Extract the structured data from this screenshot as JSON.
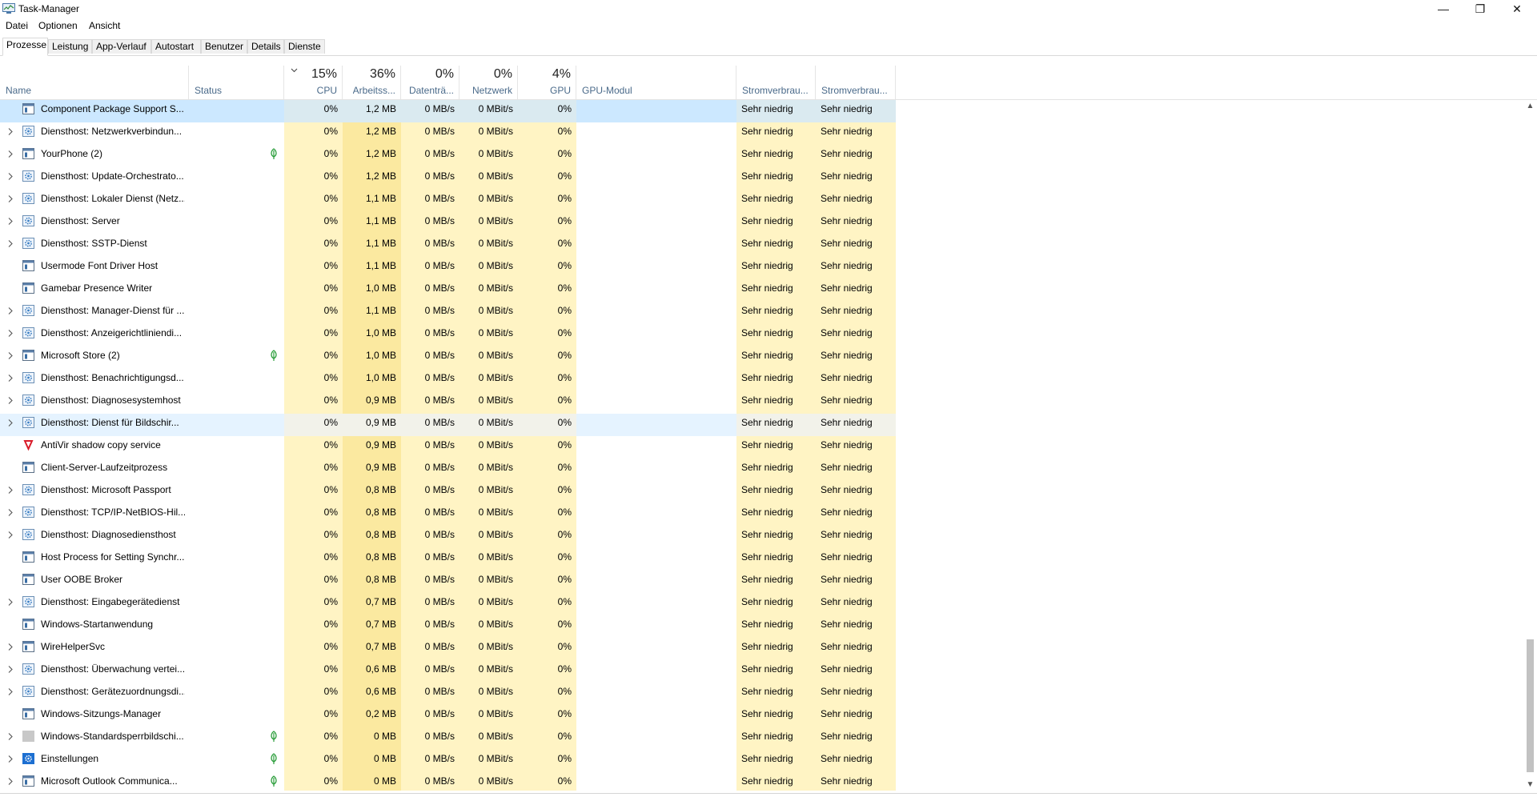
{
  "window": {
    "title": "Task-Manager",
    "minimize": "—",
    "restore": "❐",
    "close": "✕"
  },
  "menu": [
    "Datei",
    "Optionen",
    "Ansicht"
  ],
  "tabs": [
    "Prozesse",
    "Leistung",
    "App-Verlauf",
    "Autostart",
    "Benutzer",
    "Details",
    "Dienste"
  ],
  "active_tab": "Prozesse",
  "columns": {
    "name": "Name",
    "status": "Status",
    "cpu": {
      "pct": "15%",
      "label": "CPU"
    },
    "mem": {
      "pct": "36%",
      "label": "Arbeitss..."
    },
    "disk": {
      "pct": "0%",
      "label": "Datenträ..."
    },
    "net": {
      "pct": "0%",
      "label": "Netzwerk"
    },
    "gpu": {
      "pct": "4%",
      "label": "GPU"
    },
    "gpu_engine": "GPU-Modul",
    "power": "Stromverbrau...",
    "power_trend": "Stromverbrau..."
  },
  "icons": {
    "service": "gear-icon",
    "window": "window-icon",
    "antivirus": "shield-icon",
    "settings": "settings-gear-icon",
    "blank": "blank-icon",
    "suspended": "leaf-icon",
    "expand": "chevron-right-icon",
    "sort": "chevron-down-icon"
  },
  "colors": {
    "heat_light": "#fff4c4",
    "heat_medium": "#fbe9a0",
    "selection": "#cce8ff",
    "service_icon": "#3b7fc4",
    "antivirus_icon": "#d91c2a",
    "suspended_leaf": "#2a9d3a"
  },
  "rows": [
    {
      "name": "Component Package Support S...",
      "icon": "window",
      "expand": false,
      "leaf": false,
      "cpu": "0%",
      "mem": "1,2 MB",
      "disk": "0 MB/s",
      "net": "0 MBit/s",
      "gpu": "0%",
      "engine": "",
      "power": "Sehr niedrig",
      "trend": "Sehr niedrig",
      "state": "selected"
    },
    {
      "name": "Diensthost: Netzwerkverbindun...",
      "icon": "service",
      "expand": true,
      "leaf": false,
      "cpu": "0%",
      "mem": "1,2 MB",
      "disk": "0 MB/s",
      "net": "0 MBit/s",
      "gpu": "0%",
      "engine": "",
      "power": "Sehr niedrig",
      "trend": "Sehr niedrig"
    },
    {
      "name": "YourPhone (2)",
      "icon": "window",
      "expand": true,
      "leaf": true,
      "cpu": "0%",
      "mem": "1,2 MB",
      "disk": "0 MB/s",
      "net": "0 MBit/s",
      "gpu": "0%",
      "engine": "",
      "power": "Sehr niedrig",
      "trend": "Sehr niedrig"
    },
    {
      "name": "Diensthost: Update-Orchestrato...",
      "icon": "service",
      "expand": true,
      "leaf": false,
      "cpu": "0%",
      "mem": "1,2 MB",
      "disk": "0 MB/s",
      "net": "0 MBit/s",
      "gpu": "0%",
      "engine": "",
      "power": "Sehr niedrig",
      "trend": "Sehr niedrig"
    },
    {
      "name": "Diensthost: Lokaler Dienst (Netz...",
      "icon": "service",
      "expand": true,
      "leaf": false,
      "cpu": "0%",
      "mem": "1,1 MB",
      "disk": "0 MB/s",
      "net": "0 MBit/s",
      "gpu": "0%",
      "engine": "",
      "power": "Sehr niedrig",
      "trend": "Sehr niedrig"
    },
    {
      "name": "Diensthost: Server",
      "icon": "service",
      "expand": true,
      "leaf": false,
      "cpu": "0%",
      "mem": "1,1 MB",
      "disk": "0 MB/s",
      "net": "0 MBit/s",
      "gpu": "0%",
      "engine": "",
      "power": "Sehr niedrig",
      "trend": "Sehr niedrig"
    },
    {
      "name": "Diensthost: SSTP-Dienst",
      "icon": "service",
      "expand": true,
      "leaf": false,
      "cpu": "0%",
      "mem": "1,1 MB",
      "disk": "0 MB/s",
      "net": "0 MBit/s",
      "gpu": "0%",
      "engine": "",
      "power": "Sehr niedrig",
      "trend": "Sehr niedrig"
    },
    {
      "name": "Usermode Font Driver Host",
      "icon": "window",
      "expand": false,
      "leaf": false,
      "cpu": "0%",
      "mem": "1,1 MB",
      "disk": "0 MB/s",
      "net": "0 MBit/s",
      "gpu": "0%",
      "engine": "",
      "power": "Sehr niedrig",
      "trend": "Sehr niedrig"
    },
    {
      "name": "Gamebar Presence Writer",
      "icon": "window",
      "expand": false,
      "leaf": false,
      "cpu": "0%",
      "mem": "1,0 MB",
      "disk": "0 MB/s",
      "net": "0 MBit/s",
      "gpu": "0%",
      "engine": "",
      "power": "Sehr niedrig",
      "trend": "Sehr niedrig"
    },
    {
      "name": "Diensthost: Manager-Dienst für ...",
      "icon": "service",
      "expand": true,
      "leaf": false,
      "cpu": "0%",
      "mem": "1,1 MB",
      "disk": "0 MB/s",
      "net": "0 MBit/s",
      "gpu": "0%",
      "engine": "",
      "power": "Sehr niedrig",
      "trend": "Sehr niedrig"
    },
    {
      "name": "Diensthost: Anzeigerichtliniendi...",
      "icon": "service",
      "expand": true,
      "leaf": false,
      "cpu": "0%",
      "mem": "1,0 MB",
      "disk": "0 MB/s",
      "net": "0 MBit/s",
      "gpu": "0%",
      "engine": "",
      "power": "Sehr niedrig",
      "trend": "Sehr niedrig"
    },
    {
      "name": "Microsoft Store (2)",
      "icon": "window",
      "expand": true,
      "leaf": true,
      "cpu": "0%",
      "mem": "1,0 MB",
      "disk": "0 MB/s",
      "net": "0 MBit/s",
      "gpu": "0%",
      "engine": "",
      "power": "Sehr niedrig",
      "trend": "Sehr niedrig"
    },
    {
      "name": "Diensthost: Benachrichtigungsd...",
      "icon": "service",
      "expand": true,
      "leaf": false,
      "cpu": "0%",
      "mem": "1,0 MB",
      "disk": "0 MB/s",
      "net": "0 MBit/s",
      "gpu": "0%",
      "engine": "",
      "power": "Sehr niedrig",
      "trend": "Sehr niedrig"
    },
    {
      "name": "Diensthost: Diagnosesystemhost",
      "icon": "service",
      "expand": true,
      "leaf": false,
      "cpu": "0%",
      "mem": "0,9 MB",
      "disk": "0 MB/s",
      "net": "0 MBit/s",
      "gpu": "0%",
      "engine": "",
      "power": "Sehr niedrig",
      "trend": "Sehr niedrig"
    },
    {
      "name": "Diensthost: Dienst für Bildschir...",
      "icon": "service",
      "expand": true,
      "leaf": false,
      "cpu": "0%",
      "mem": "0,9 MB",
      "disk": "0 MB/s",
      "net": "0 MBit/s",
      "gpu": "0%",
      "engine": "",
      "power": "Sehr niedrig",
      "trend": "Sehr niedrig",
      "state": "hover"
    },
    {
      "name": "AntiVir shadow copy service",
      "icon": "antivirus",
      "expand": false,
      "leaf": false,
      "cpu": "0%",
      "mem": "0,9 MB",
      "disk": "0 MB/s",
      "net": "0 MBit/s",
      "gpu": "0%",
      "engine": "",
      "power": "Sehr niedrig",
      "trend": "Sehr niedrig"
    },
    {
      "name": "Client-Server-Laufzeitprozess",
      "icon": "window",
      "expand": false,
      "leaf": false,
      "cpu": "0%",
      "mem": "0,9 MB",
      "disk": "0 MB/s",
      "net": "0 MBit/s",
      "gpu": "0%",
      "engine": "",
      "power": "Sehr niedrig",
      "trend": "Sehr niedrig"
    },
    {
      "name": "Diensthost: Microsoft Passport",
      "icon": "service",
      "expand": true,
      "leaf": false,
      "cpu": "0%",
      "mem": "0,8 MB",
      "disk": "0 MB/s",
      "net": "0 MBit/s",
      "gpu": "0%",
      "engine": "",
      "power": "Sehr niedrig",
      "trend": "Sehr niedrig"
    },
    {
      "name": "Diensthost: TCP/IP-NetBIOS-Hil...",
      "icon": "service",
      "expand": true,
      "leaf": false,
      "cpu": "0%",
      "mem": "0,8 MB",
      "disk": "0 MB/s",
      "net": "0 MBit/s",
      "gpu": "0%",
      "engine": "",
      "power": "Sehr niedrig",
      "trend": "Sehr niedrig"
    },
    {
      "name": "Diensthost: Diagnosediensthost",
      "icon": "service",
      "expand": true,
      "leaf": false,
      "cpu": "0%",
      "mem": "0,8 MB",
      "disk": "0 MB/s",
      "net": "0 MBit/s",
      "gpu": "0%",
      "engine": "",
      "power": "Sehr niedrig",
      "trend": "Sehr niedrig"
    },
    {
      "name": "Host Process for Setting Synchr...",
      "icon": "window",
      "expand": false,
      "leaf": false,
      "cpu": "0%",
      "mem": "0,8 MB",
      "disk": "0 MB/s",
      "net": "0 MBit/s",
      "gpu": "0%",
      "engine": "",
      "power": "Sehr niedrig",
      "trend": "Sehr niedrig"
    },
    {
      "name": "User OOBE Broker",
      "icon": "window",
      "expand": false,
      "leaf": false,
      "cpu": "0%",
      "mem": "0,8 MB",
      "disk": "0 MB/s",
      "net": "0 MBit/s",
      "gpu": "0%",
      "engine": "",
      "power": "Sehr niedrig",
      "trend": "Sehr niedrig"
    },
    {
      "name": "Diensthost: Eingabegerätedienst",
      "icon": "service",
      "expand": true,
      "leaf": false,
      "cpu": "0%",
      "mem": "0,7 MB",
      "disk": "0 MB/s",
      "net": "0 MBit/s",
      "gpu": "0%",
      "engine": "",
      "power": "Sehr niedrig",
      "trend": "Sehr niedrig"
    },
    {
      "name": "Windows-Startanwendung",
      "icon": "window",
      "expand": false,
      "leaf": false,
      "cpu": "0%",
      "mem": "0,7 MB",
      "disk": "0 MB/s",
      "net": "0 MBit/s",
      "gpu": "0%",
      "engine": "",
      "power": "Sehr niedrig",
      "trend": "Sehr niedrig"
    },
    {
      "name": "WireHelperSvc",
      "icon": "window",
      "expand": true,
      "leaf": false,
      "cpu": "0%",
      "mem": "0,7 MB",
      "disk": "0 MB/s",
      "net": "0 MBit/s",
      "gpu": "0%",
      "engine": "",
      "power": "Sehr niedrig",
      "trend": "Sehr niedrig"
    },
    {
      "name": "Diensthost: Überwachung vertei...",
      "icon": "service",
      "expand": true,
      "leaf": false,
      "cpu": "0%",
      "mem": "0,6 MB",
      "disk": "0 MB/s",
      "net": "0 MBit/s",
      "gpu": "0%",
      "engine": "",
      "power": "Sehr niedrig",
      "trend": "Sehr niedrig"
    },
    {
      "name": "Diensthost: Gerätezuordnungsdi...",
      "icon": "service",
      "expand": true,
      "leaf": false,
      "cpu": "0%",
      "mem": "0,6 MB",
      "disk": "0 MB/s",
      "net": "0 MBit/s",
      "gpu": "0%",
      "engine": "",
      "power": "Sehr niedrig",
      "trend": "Sehr niedrig"
    },
    {
      "name": "Windows-Sitzungs-Manager",
      "icon": "window",
      "expand": false,
      "leaf": false,
      "cpu": "0%",
      "mem": "0,2 MB",
      "disk": "0 MB/s",
      "net": "0 MBit/s",
      "gpu": "0%",
      "engine": "",
      "power": "Sehr niedrig",
      "trend": "Sehr niedrig"
    },
    {
      "name": "Windows-Standardsperrbildschi...",
      "icon": "blank",
      "expand": true,
      "leaf": true,
      "cpu": "0%",
      "mem": "0 MB",
      "disk": "0 MB/s",
      "net": "0 MBit/s",
      "gpu": "0%",
      "engine": "",
      "power": "Sehr niedrig",
      "trend": "Sehr niedrig"
    },
    {
      "name": "Einstellungen",
      "icon": "settings",
      "expand": true,
      "leaf": true,
      "cpu": "0%",
      "mem": "0 MB",
      "disk": "0 MB/s",
      "net": "0 MBit/s",
      "gpu": "0%",
      "engine": "",
      "power": "Sehr niedrig",
      "trend": "Sehr niedrig"
    },
    {
      "name": "Microsoft Outlook Communica...",
      "icon": "window",
      "expand": true,
      "leaf": true,
      "cpu": "0%",
      "mem": "0 MB",
      "disk": "0 MB/s",
      "net": "0 MBit/s",
      "gpu": "0%",
      "engine": "",
      "power": "Sehr niedrig",
      "trend": "Sehr niedrig"
    }
  ]
}
